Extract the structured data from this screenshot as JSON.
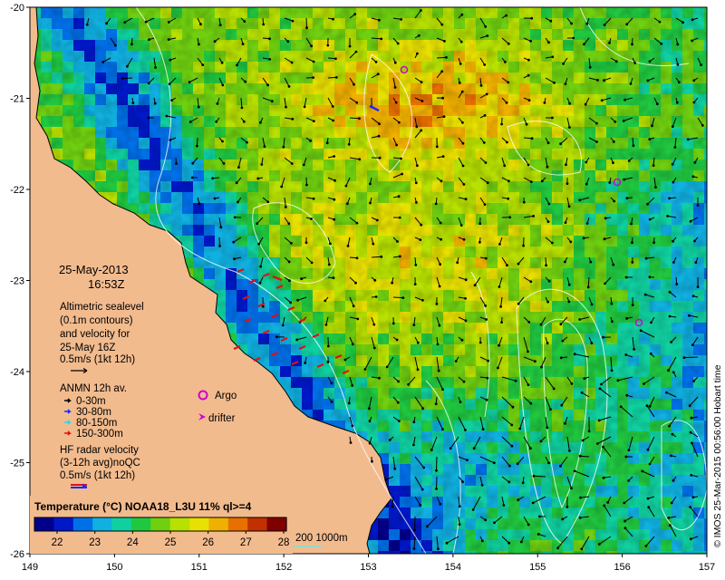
{
  "map": {
    "lon_ticks": [
      "149",
      "150",
      "151",
      "152",
      "153",
      "154",
      "155",
      "156",
      "157"
    ],
    "lat_ticks": [
      "-20",
      "-21",
      "-22",
      "-23",
      "-24",
      "-25",
      "-26"
    ],
    "date": "25-May-2013",
    "time": "16:53Z",
    "altimetry_lines": [
      "Altimetric sealevel",
      "(0.1m contours)",
      "and velocity for",
      "25-May 16Z",
      "0.5m/s (1kt 12h)"
    ],
    "anmn_title": "ANMN 12h av.",
    "anmn_depths": [
      {
        "label": "0-30m",
        "color": "#000000"
      },
      {
        "label": "30-80m",
        "color": "#1b2cff"
      },
      {
        "label": "80-150m",
        "color": "#2fd3e8"
      },
      {
        "label": "150-300m",
        "color": "#e01010"
      }
    ],
    "argo_label": "Argo",
    "drifter_label": "drifter",
    "hf_lines": [
      "HF radar velocity",
      "(3-12h avg)noQC",
      "0.5m/s (1kt 12h)"
    ],
    "colorbar_title": "Temperature (°C) NOAA18_L3U 11% ql>=4",
    "colorbar_ticks": [
      "22",
      "23",
      "24",
      "25",
      "26",
      "27",
      "28"
    ],
    "bathy_label": "200  1000m",
    "side_text": "© IMOS 25-Mar-2015 00:56:00 Hobart time",
    "colors": {
      "land": "#f2bb8e",
      "argo": "#d000d0",
      "drifter": "#d000d0",
      "hf_blue": "#1b2cff",
      "hf_red": "#e01010",
      "bathy": "#7de0d8"
    },
    "colormap": [
      "#00008a",
      "#0018c8",
      "#0070e8",
      "#10b0e0",
      "#10d0a0",
      "#20c840",
      "#70d010",
      "#b8e000",
      "#e8e000",
      "#f0b000",
      "#e87000",
      "#c03000",
      "#800000"
    ]
  }
}
